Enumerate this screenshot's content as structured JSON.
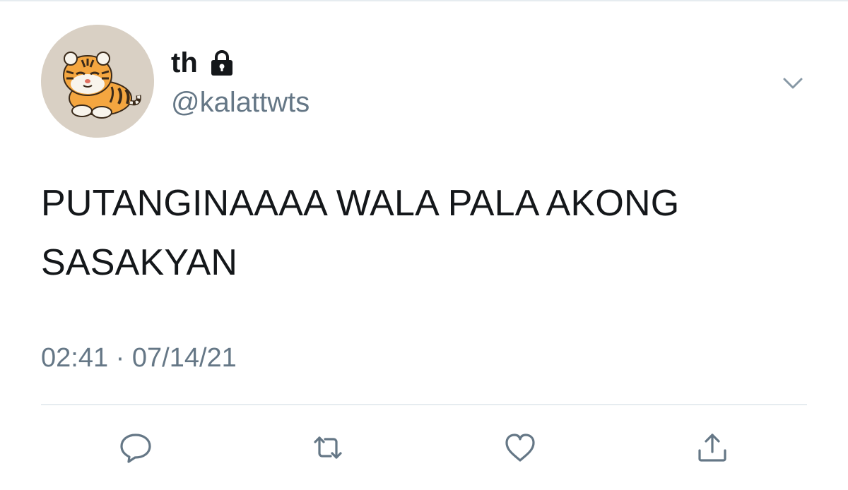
{
  "tweet": {
    "display_name": "th",
    "handle": "@kalattwts",
    "text_line1": "PUTANGINAAAA WALA PALA AKONG",
    "text_line2": "SASAKYAN",
    "time": "02:41",
    "separator": "·",
    "date": "07/14/21"
  },
  "icons": {
    "lock": "lock-icon",
    "menu": "chevron-down-icon",
    "reply": "reply-icon",
    "retweet": "retweet-icon",
    "like": "heart-icon",
    "share": "share-icon"
  },
  "colors": {
    "text_primary": "#14171a",
    "text_secondary": "#657786",
    "divider": "#e6ecf0",
    "avatar_bg": "#d9d0c4"
  }
}
